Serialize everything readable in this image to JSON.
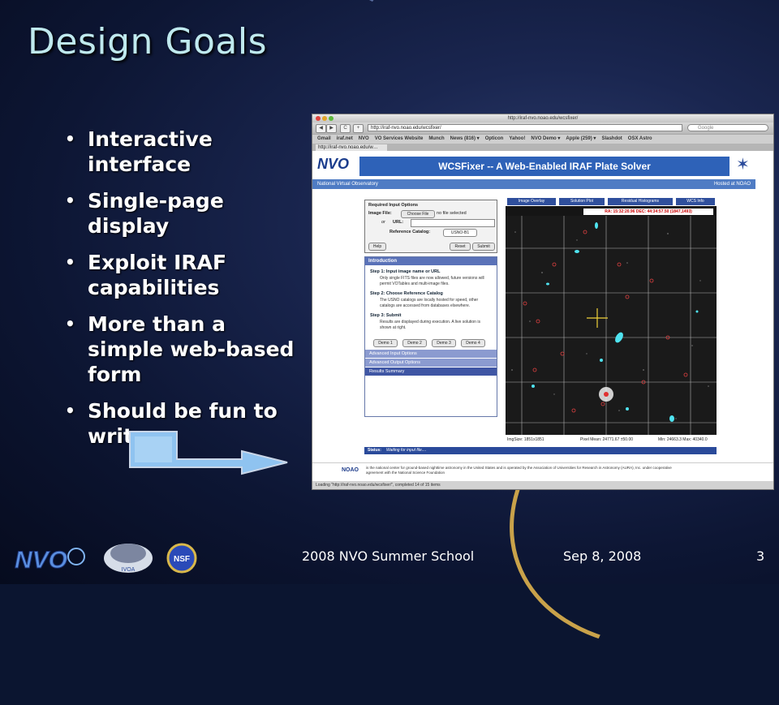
{
  "slide": {
    "title": "Design Goals",
    "bullets": [
      "Interactive interface",
      "Single-page display",
      "Exploit IRAF capabilities",
      "More than a simple web-based form",
      "Should be fun to write"
    ],
    "footer_center": "2008 NVO Summer School",
    "footer_date": "Sep 8, 2008",
    "page_number": "3",
    "logos": [
      "NVO",
      "IVOA",
      "NSF"
    ]
  },
  "colors": {
    "title": "#bfe9ee",
    "banner": "#2e62b8",
    "status_bar": "#2a4a9a"
  },
  "browser": {
    "window_title": "http://iraf-nvo.noao.edu/wcsfixer/",
    "nav": [
      "◀",
      "▶",
      "C",
      "+"
    ],
    "url": "http://iraf-nvo.noao.edu/wcsfixer/",
    "search_placeholder": "Google",
    "bookmarks": [
      "Gmail",
      "iraf.net",
      "NVO",
      "VO Services Website",
      "Munch",
      "News (816) ▾",
      "Opticon",
      "Yahoo!",
      "NVO Demo ▾",
      "Apple (259) ▾",
      "Slashdot",
      "OSX Astro"
    ],
    "tab_label": "http://iraf-nvo.noao.edu/w…",
    "loading_status": "Loading \"http://iraf-nvo.noao.edu/wcsfixer/\", completed 14 of 15 items"
  },
  "webpage": {
    "logo": "NVO",
    "banner_title": "WCSFixer -- A Web-Enabled IRAF Plate Solver",
    "org_left": "National Virtual Observatory",
    "org_right": "Hosted at NOAO",
    "form": {
      "heading": "Required Input Options",
      "image_file_label": "Image File:",
      "choose_file": "Choose File",
      "no_file": "no file selected",
      "or_label": "or",
      "url_label": "URL:",
      "ref_catalog_label": "Reference Catalog:",
      "ref_catalog_value": "USNO-B1",
      "help": "Help",
      "reset": "Reset",
      "submit": "Submit"
    },
    "intro": {
      "heading": "Introduction",
      "steps": [
        {
          "title": "Step 1: Input image name or URL",
          "text": "Only single FITS files are now allowed, future versions will permit VOTables and multi-image files."
        },
        {
          "title": "Step 2: Choose Reference Catalog",
          "text": "The USNO catalogs are locally hosted for speed, other catalogs are accessed from databases elsewhere."
        },
        {
          "title": "Step 3: Submit",
          "text": "Results are displayed during execution. A live solution is shown at right."
        }
      ],
      "demos": [
        "Demo 1",
        "Demo 2",
        "Demo 3",
        "Demo 4"
      ],
      "advanced_input": "Advanced Input Options",
      "advanced_output": "Advanced Output Options",
      "results_summary": "Results Summary"
    },
    "image_tabs": [
      "Image Overlay",
      "Solution Plot",
      "Residual Histograms",
      "WCS Info"
    ],
    "coord_readout": "RA: 15:32:20.96  DEC: 44:34:57.50  (1847,1493)",
    "image_size": "ImgSize: 1851x1851",
    "pixel_mean": "Pixel Mean: 24771.67 ±50.00",
    "minmax": "Min: 24663.3  Max: 40340.0",
    "status_label": "Status:",
    "status_value": "Waiting for input file....",
    "footer_noao": "NOAO",
    "footer_text": "is the national center for ground-based nighttime astronomy in the United States and is operated by the Association of Universities for Research in Astronomy (AURA), Inc. under cooperative agreement with the National Science Foundation"
  }
}
